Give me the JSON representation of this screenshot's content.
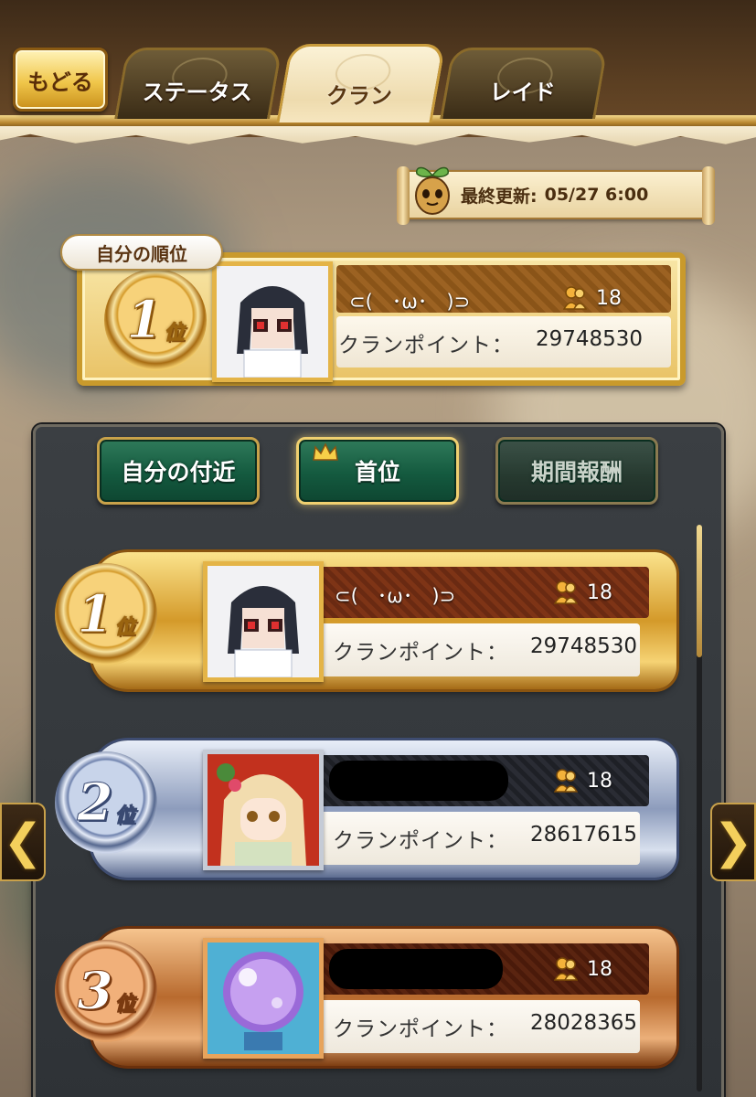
{
  "header": {
    "back_label": "もどる",
    "tabs": [
      {
        "label": "ステータス",
        "active": false
      },
      {
        "label": "クラン",
        "active": true
      },
      {
        "label": "レイド",
        "active": false
      }
    ]
  },
  "last_updated": {
    "label": "最終更新:",
    "value": "05/27 6:00"
  },
  "my_rank": {
    "tag_label": "自分の順位",
    "rank_number": "1",
    "rank_suffix": "位",
    "clan_name": "⊂(　･ω･　)⊃",
    "members": "18",
    "points_label": "クランポイント：",
    "points_value": "29748530"
  },
  "filters": [
    {
      "label": "自分の付近",
      "state": "normal"
    },
    {
      "label": "首位",
      "state": "active"
    },
    {
      "label": "期間報酬",
      "state": "disabled"
    }
  ],
  "ranking": [
    {
      "rank_number": "1",
      "rank_suffix": "位",
      "tier": "gold",
      "clan_name": "⊂(　･ω･　)⊃",
      "members": "18",
      "points_label": "クランポイント：",
      "points_value": "29748530",
      "name_redacted": false
    },
    {
      "rank_number": "2",
      "rank_suffix": "位",
      "tier": "silver",
      "clan_name": "",
      "members": "18",
      "points_label": "クランポイント：",
      "points_value": "28617615",
      "name_redacted": true
    },
    {
      "rank_number": "3",
      "rank_suffix": "位",
      "tier": "bronze",
      "clan_name": "",
      "members": "18",
      "points_label": "クランポイント：",
      "points_value": "28028365",
      "name_redacted": true
    }
  ],
  "navigation": {
    "prev_glyph": "❮",
    "next_glyph": "❯"
  },
  "icons": {
    "member": "member-icon",
    "crown": "crown-icon",
    "sprout": "sprout-mascot-icon"
  },
  "colors": {
    "gold": "#e4b447",
    "silver": "#c5cbd6",
    "bronze": "#e7a45c",
    "button_green": "#145a3f"
  }
}
